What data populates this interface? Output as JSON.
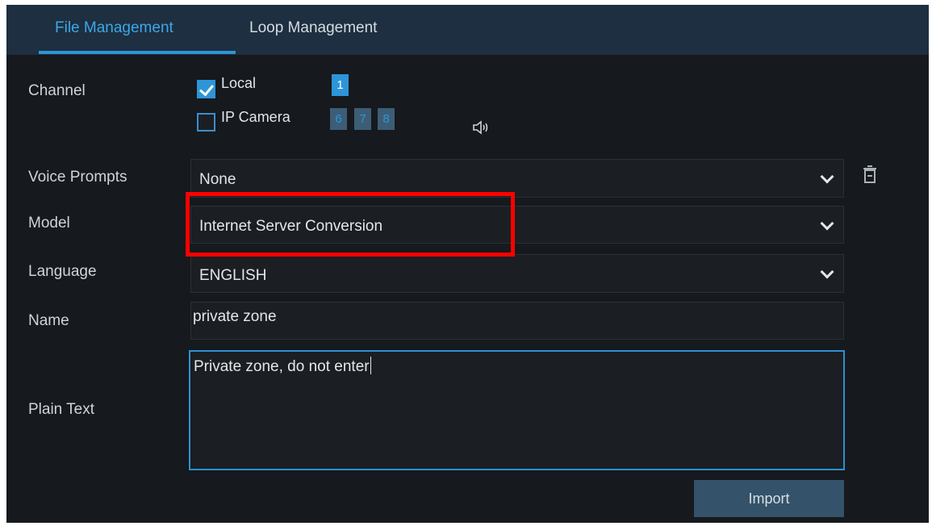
{
  "tabs": [
    {
      "label": "File Management",
      "active": true
    },
    {
      "label": "Loop Management",
      "active": false
    }
  ],
  "channel": {
    "label": "Channel",
    "local": {
      "label": "Local",
      "checked": true,
      "channels": [
        "1"
      ]
    },
    "ip_camera": {
      "label": "IP Camera",
      "checked": false,
      "channels": [
        "6",
        "7",
        "8"
      ]
    },
    "sound_icon": "speaker-icon"
  },
  "voice_prompts": {
    "label": "Voice Prompts",
    "value": "None",
    "icon": "trash-icon"
  },
  "model": {
    "label": "Model",
    "value": "Internet Server Conversion"
  },
  "language": {
    "label": "Language",
    "value": "ENGLISH"
  },
  "name": {
    "label": "Name",
    "value": "private zone"
  },
  "plain_text": {
    "label": "Plain Text",
    "value": "Private zone, do not enter"
  },
  "import_label": "Import",
  "colors": {
    "accent": "#2d95d8",
    "tabbar": "#1d2f40",
    "highlight": "#ff0000"
  }
}
